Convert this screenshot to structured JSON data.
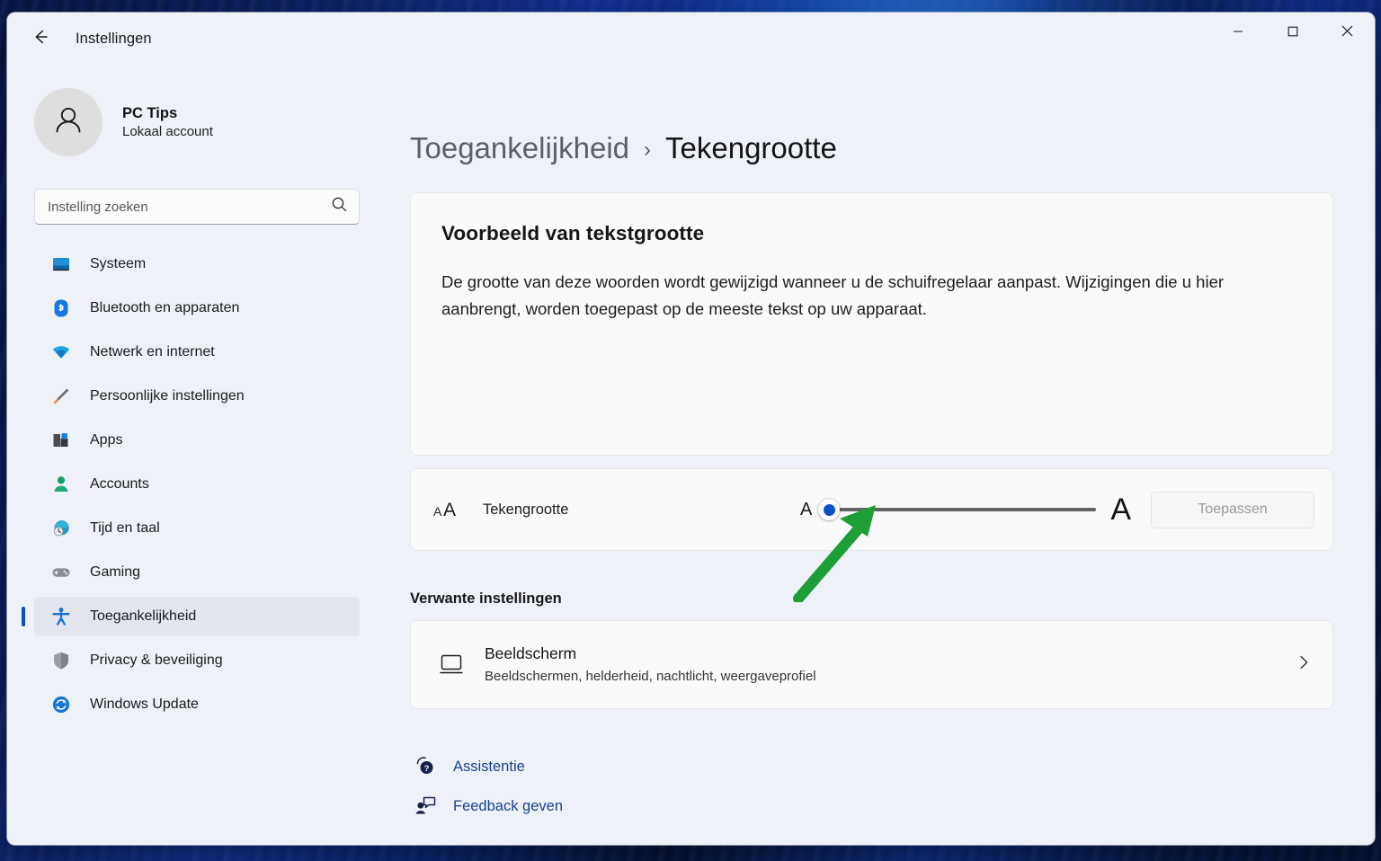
{
  "window": {
    "app_title": "Instellingen",
    "back_icon": "back-arrow-icon",
    "controls": {
      "minimize": "minimize-icon",
      "maximize": "maximize-icon",
      "close": "close-icon"
    }
  },
  "sidebar": {
    "account": {
      "name": "PC Tips",
      "subtitle": "Lokaal account",
      "avatar_icon": "person-avatar-icon"
    },
    "search": {
      "placeholder": "Instelling zoeken",
      "value": "",
      "icon": "search-icon"
    },
    "items": [
      {
        "label": "Systeem",
        "icon": "system-monitor-icon",
        "active": false
      },
      {
        "label": "Bluetooth en apparaten",
        "icon": "bluetooth-icon",
        "active": false
      },
      {
        "label": "Netwerk en internet",
        "icon": "wifi-icon",
        "active": false
      },
      {
        "label": "Persoonlijke instellingen",
        "icon": "paintbrush-icon",
        "active": false
      },
      {
        "label": "Apps",
        "icon": "apps-grid-icon",
        "active": false
      },
      {
        "label": "Accounts",
        "icon": "account-person-icon",
        "active": false
      },
      {
        "label": "Tijd en taal",
        "icon": "clock-globe-icon",
        "active": false
      },
      {
        "label": "Gaming",
        "icon": "gamepad-icon",
        "active": false
      },
      {
        "label": "Toegankelijkheid",
        "icon": "accessibility-person-icon",
        "active": true
      },
      {
        "label": "Privacy & beveiliging",
        "icon": "shield-icon",
        "active": false
      },
      {
        "label": "Windows Update",
        "icon": "update-refresh-icon",
        "active": false
      }
    ]
  },
  "main": {
    "breadcrumb": {
      "parent": "Toegankelijkheid",
      "separator": "›",
      "current": "Tekengrootte"
    },
    "preview_card": {
      "title": "Voorbeeld van tekstgrootte",
      "body": "De grootte van deze woorden wordt gewijzigd wanneer u de schuifregelaar aanpast. Wijzigingen die u hier aanbrengt, worden toegepast op de meeste tekst op uw apparaat."
    },
    "slider_card": {
      "icon": "text-size-aa-icon",
      "label": "Tekengrootte",
      "small_a": "A",
      "large_a": "A",
      "slider_value": 0,
      "slider_min": 0,
      "slider_max": 100,
      "thumb_color": "#0b53c4",
      "apply_label": "Toepassen",
      "apply_enabled": false
    },
    "related": {
      "heading": "Verwante instellingen",
      "item": {
        "icon": "monitor-icon",
        "title": "Beeldscherm",
        "subtitle": "Beeldschermen, helderheid, nachtlicht, weergaveprofiel",
        "chevron": "chevron-right-icon"
      }
    },
    "bottom_links": [
      {
        "label": "Assistentie",
        "icon": "help-question-icon"
      },
      {
        "label": "Feedback geven",
        "icon": "feedback-person-icon"
      }
    ]
  },
  "annotation": {
    "arrow_color": "#1d9e36",
    "arrow_name": "green-annotation-arrow"
  }
}
